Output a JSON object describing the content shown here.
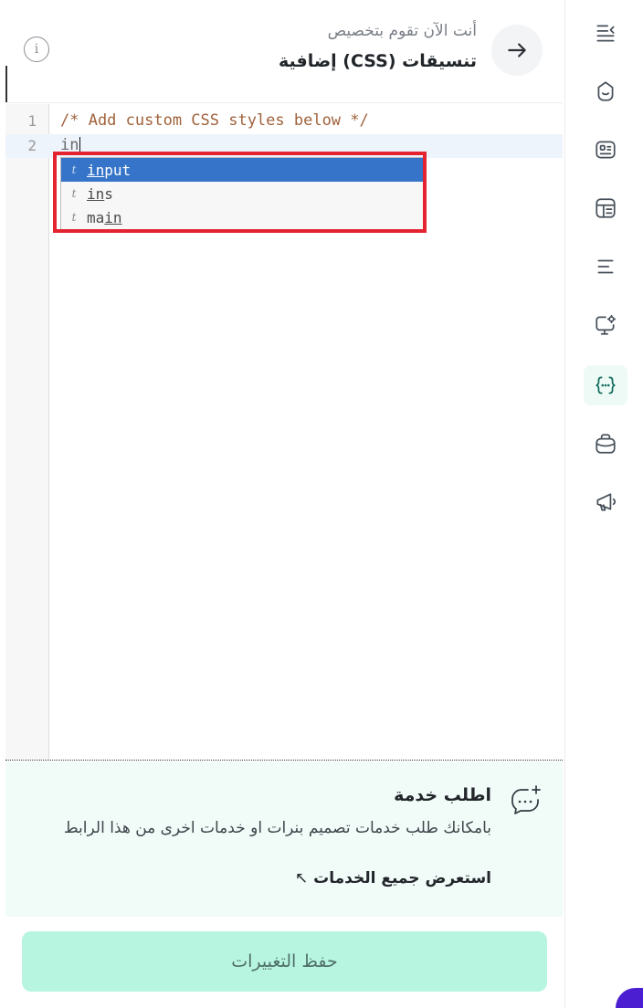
{
  "header": {
    "subtitle": "أنت الآن تقوم بتخصيص",
    "title": "تنسيقات (CSS) إضافية"
  },
  "editor": {
    "lines": [
      {
        "number": "1",
        "text": "/* Add custom CSS styles below */"
      },
      {
        "number": "2",
        "text": "in"
      }
    ],
    "hints": [
      {
        "kind": "t",
        "match": "in",
        "rest": "put",
        "prefix": "",
        "suffix": ""
      },
      {
        "kind": "t",
        "match": "in",
        "rest": "s",
        "prefix": "",
        "suffix": ""
      },
      {
        "kind": "t",
        "prefix": "ma",
        "match": "in",
        "rest": ""
      }
    ]
  },
  "service": {
    "title": "اطلب خدمة",
    "description": "بامكانك طلب خدمات تصميم بنرات او خدمات اخرى من هذا الرابط",
    "link_label": "استعرض جميع الخدمات",
    "link_arrow": "↖"
  },
  "save": {
    "label": "حفظ التغييرات"
  },
  "sidebar": {
    "items": [
      {
        "icon": "collapse-menu-icon"
      },
      {
        "icon": "smile-icon"
      },
      {
        "icon": "id-card-icon"
      },
      {
        "icon": "layout-template-icon"
      },
      {
        "icon": "align-lines-icon"
      },
      {
        "icon": "monitor-settings-icon"
      },
      {
        "icon": "code-braces-icon",
        "active": true
      },
      {
        "icon": "briefcase-icon"
      },
      {
        "icon": "megaphone-icon"
      }
    ]
  },
  "colors": {
    "accent": "#b7f5e1",
    "service_bg": "#f1fbf8",
    "hint_selected": "#3574c9",
    "highlight_outline": "#e3232f"
  }
}
